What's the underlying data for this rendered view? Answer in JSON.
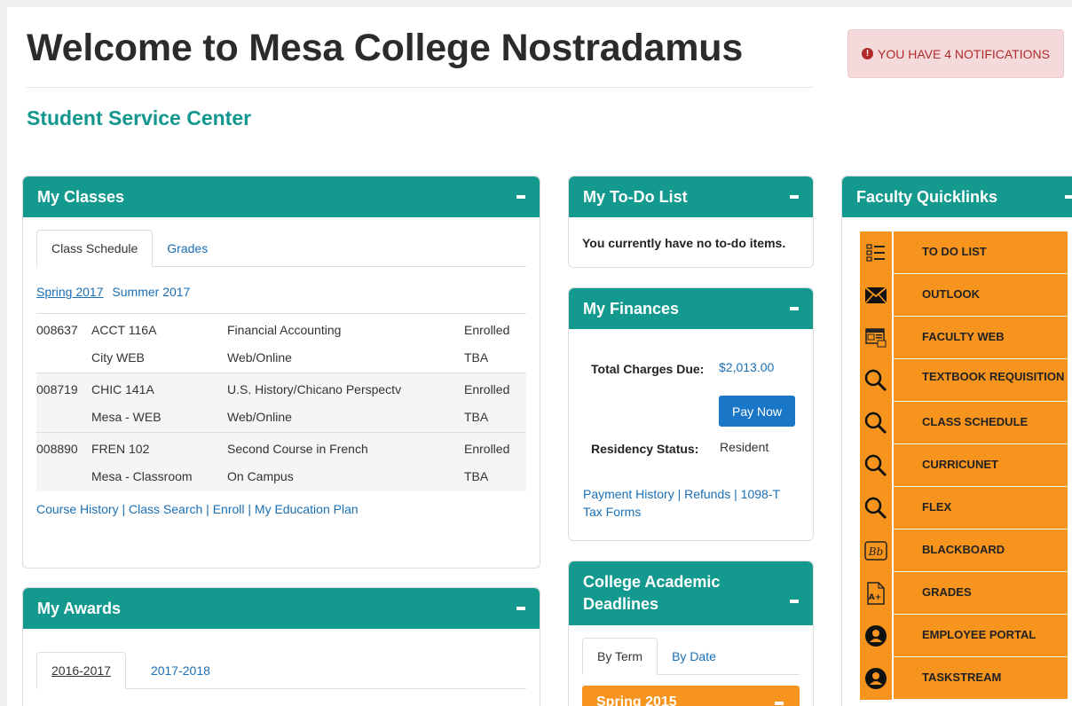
{
  "header": {
    "title": "Welcome to Mesa College Nostradamus",
    "subtitle": "Student Service Center",
    "notification": "YOU HAVE 4 NOTIFICATIONS"
  },
  "my_classes": {
    "title": "My Classes",
    "tabs": [
      "Class Schedule",
      "Grades"
    ],
    "terms": [
      "Spring 2017",
      "Summer 2017"
    ],
    "classes": [
      {
        "crn": "008637",
        "course": "ACCT 116A",
        "title": "Financial Accounting",
        "status": "Enrolled",
        "location": "City WEB",
        "mode": "Web/Online",
        "time": "TBA"
      },
      {
        "crn": "008719",
        "course": "CHIC 141A",
        "title": "U.S. History/Chicano Perspectv",
        "status": "Enrolled",
        "location": "Mesa - WEB",
        "mode": "Web/Online",
        "time": "TBA"
      },
      {
        "crn": "008890",
        "course": "FREN 102",
        "title": "Second Course in French",
        "status": "Enrolled",
        "location": "Mesa - Classroom",
        "mode": "On Campus",
        "time": "TBA"
      }
    ],
    "footer_links": [
      "Course History",
      "Class Search",
      "Enroll",
      "My Education Plan"
    ]
  },
  "my_awards": {
    "title": "My Awards",
    "tabs": [
      "2016-2017",
      "2017-2018"
    ]
  },
  "todo": {
    "title": "My To-Do List",
    "message": "You currently have no to-do items."
  },
  "finances": {
    "title": "My Finances",
    "charges_label": "Total Charges Due:",
    "charges_value": "$2,013.00",
    "pay_button": "Pay Now",
    "residency_label": "Residency Status:",
    "residency_value": "Resident",
    "links_line1": "Payment History | Refunds | 1098-T",
    "links_line2": "Tax Forms"
  },
  "deadlines": {
    "title_line1": "College Academic",
    "title_line2": "Deadlines",
    "tabs": [
      "By Term",
      "By Date"
    ],
    "term_header": "Spring 2015"
  },
  "quicklinks": {
    "title": "Faculty Quicklinks",
    "items": [
      {
        "label": "TO DO LIST",
        "icon": "checklist-icon"
      },
      {
        "label": "OUTLOOK",
        "icon": "envelope-icon"
      },
      {
        "label": "FACULTY WEB",
        "icon": "web-page-icon"
      },
      {
        "label": "TEXTBOOK REQUISITION",
        "icon": "magnifier-icon"
      },
      {
        "label": "CLASS SCHEDULE",
        "icon": "magnifier-icon"
      },
      {
        "label": "CURRICUNET",
        "icon": "magnifier-icon"
      },
      {
        "label": "FLEX",
        "icon": "magnifier-icon"
      },
      {
        "label": "BLACKBOARD",
        "icon": "blackboard-icon"
      },
      {
        "label": "GRADES",
        "icon": "grade-document-icon"
      },
      {
        "label": "EMPLOYEE PORTAL",
        "icon": "person-icon"
      },
      {
        "label": "TASKSTREAM",
        "icon": "person-icon"
      }
    ]
  },
  "colors": {
    "teal": "#14998f",
    "orange": "#f7941d",
    "link": "#1a6fb5",
    "alert": "#b02a2a"
  }
}
